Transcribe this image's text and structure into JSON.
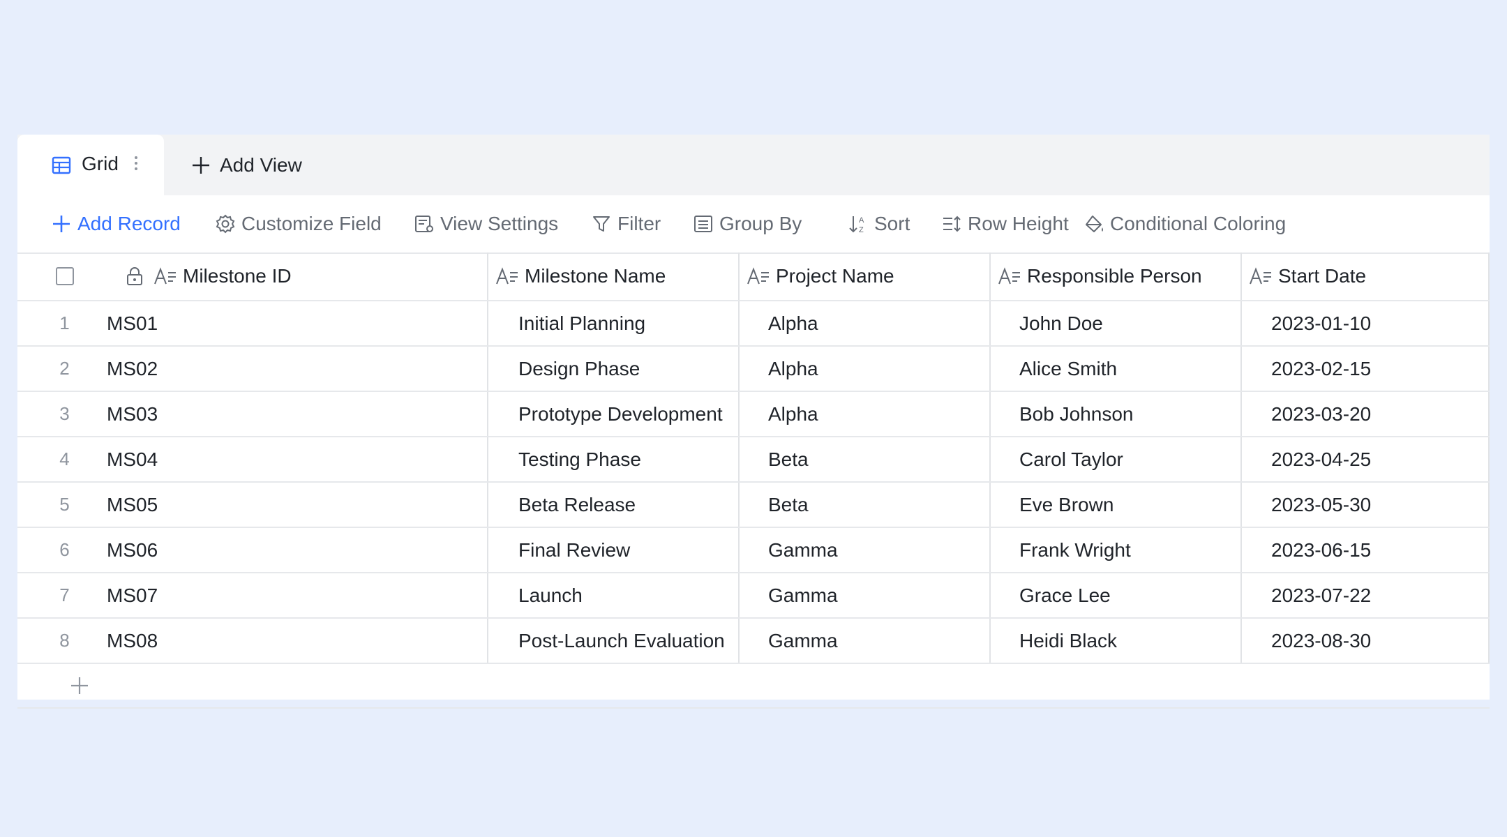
{
  "tabs": {
    "active_label": "Grid",
    "add_view_label": "Add View"
  },
  "toolbar": {
    "add_record": "Add Record",
    "customize_field": "Customize Field",
    "view_settings": "View Settings",
    "filter": "Filter",
    "group_by": "Group By",
    "sort": "Sort",
    "row_height": "Row Height",
    "conditional_coloring": "Conditional Coloring"
  },
  "table": {
    "columns": [
      "Milestone ID",
      "Milestone Name",
      "Project Name",
      "Responsible Person",
      "Start Date"
    ],
    "rows": [
      {
        "num": "1",
        "id": "MS01",
        "name": "Initial Planning",
        "project": "Alpha",
        "person": "John Doe",
        "date": "2023-01-10"
      },
      {
        "num": "2",
        "id": "MS02",
        "name": "Design Phase",
        "project": "Alpha",
        "person": "Alice Smith",
        "date": "2023-02-15"
      },
      {
        "num": "3",
        "id": "MS03",
        "name": "Prototype Development",
        "project": "Alpha",
        "person": "Bob Johnson",
        "date": "2023-03-20"
      },
      {
        "num": "4",
        "id": "MS04",
        "name": "Testing Phase",
        "project": "Beta",
        "person": "Carol Taylor",
        "date": "2023-04-25"
      },
      {
        "num": "5",
        "id": "MS05",
        "name": "Beta Release",
        "project": "Beta",
        "person": "Eve Brown",
        "date": "2023-05-30"
      },
      {
        "num": "6",
        "id": "MS06",
        "name": "Final Review",
        "project": "Gamma",
        "person": "Frank Wright",
        "date": "2023-06-15"
      },
      {
        "num": "7",
        "id": "MS07",
        "name": "Launch",
        "project": "Gamma",
        "person": "Grace Lee",
        "date": "2023-07-22"
      },
      {
        "num": "8",
        "id": "MS08",
        "name": "Post-Launch Evaluation",
        "project": "Gamma",
        "person": "Heidi Black",
        "date": "2023-08-30"
      }
    ]
  },
  "colors": {
    "accent": "#3370ff",
    "page_background": "#e7eefc",
    "muted_text": "#646a73"
  }
}
